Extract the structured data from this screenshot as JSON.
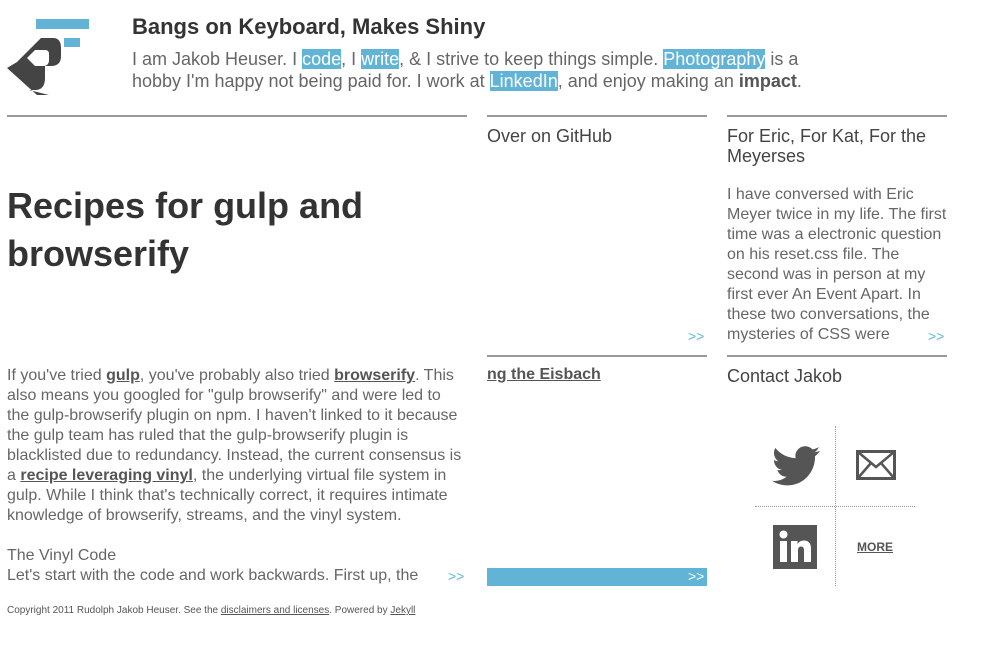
{
  "header": {
    "site_title": "Bangs on Keyboard, Makes Shiny",
    "intro": {
      "t1": "I am Jakob Heuser. I ",
      "code": "code",
      "t2": ", I ",
      "write": "write",
      "t3": ", & I strive to keep things simple. ",
      "photography": "Photography",
      "t4": " is a hobby I'm happy not being paid for. I work at ",
      "linkedin": "LinkedIn",
      "t5": ", and enjoy making an ",
      "impact": "impact",
      "t6": "."
    }
  },
  "post": {
    "title": "Recipes for gulp and browserify",
    "excerpt": {
      "t1": "If you've tried ",
      "gulp": "gulp",
      "t2": ", you've probably also tried ",
      "browserify": "browserify",
      "t3": ". This also means you googled for \"gulp browserify\" and were led to the gulp-browserify plugin on npm. I haven't linked to it because the gulp team has ruled that the gulp-browserify plugin is blacklisted due to redundancy. Instead, the current consensus is a ",
      "recipe": "recipe leveraging vinyl",
      "t4": ", the underlying virtual file system in gulp. While I think that's technically correct, it requires intimate knowledge of browserify, streams, and the vinyl system.",
      "subhead": "The Vinyl Code",
      "t5": "Let's start with the code and work backwards. First up, the"
    },
    "more": ">>"
  },
  "github": {
    "heading": "Over on GitHub",
    "more": ">>"
  },
  "eric": {
    "heading": "For Eric, For Kat, For the Meyerses",
    "text": "I have conversed with Eric Meyer twice in my life. The first time was a electronic question on his reset.css file. The second was in person at my first ever An Event Apart. In these two conversations, the mysteries of CSS were",
    "more": ">>"
  },
  "eisbach": {
    "link": "ng the Eisbach",
    "more": ">>"
  },
  "contact": {
    "heading": "Contact Jakob",
    "more": "MORE",
    "icons": [
      "twitter-icon",
      "email-icon",
      "linkedin-icon"
    ]
  },
  "footer": {
    "t1": "Copyright 2011 Rudolph Jakob Heuser. See the ",
    "disclaimers": "disclaimers and licenses",
    "t2": ". Powered by ",
    "jekyll": "Jekyll"
  },
  "colors": {
    "accent": "#62b4d6",
    "text": "#666666",
    "rule": "#999999",
    "icon": "#555555"
  }
}
